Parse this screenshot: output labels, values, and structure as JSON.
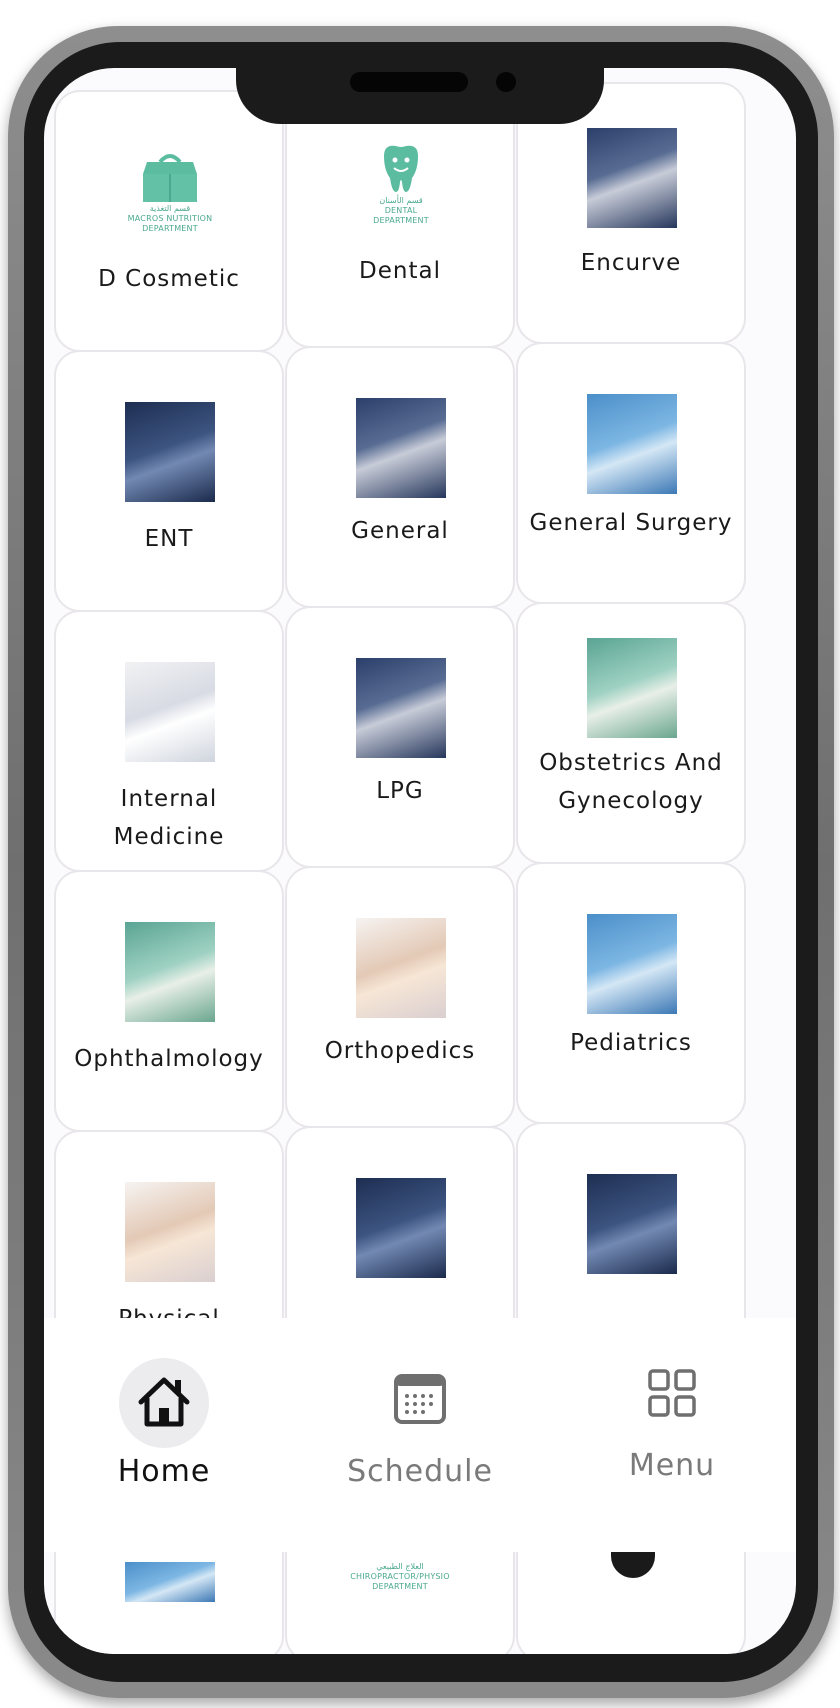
{
  "departments": [
    {
      "label": "D Cosmetic",
      "image": "macros-nutrition-logo",
      "logo_text": "قسم التغذية\nMACROS NUTRITION\nDEPARTMENT"
    },
    {
      "label": "Dental",
      "image": "dental-tooth-logo",
      "logo_text": "قسم الأسنان\nDENTAL\nDEPARTMENT"
    },
    {
      "label": "Encurve",
      "image": "encurve-photo"
    },
    {
      "label": "ENT",
      "image": "ent-photo"
    },
    {
      "label": "General",
      "image": "general-photo"
    },
    {
      "label": "General Surgery",
      "image": "general-surgery-photo"
    },
    {
      "label": "Internal Medicine",
      "image": "internal-medicine-photo"
    },
    {
      "label": "LPG",
      "image": "lpg-photo"
    },
    {
      "label": "Obstetrics And Gynecology",
      "image": "obstetrics-photo"
    },
    {
      "label": "Ophthalmology",
      "image": "ophthalmology-photo"
    },
    {
      "label": "Orthopedics",
      "image": "orthopedics-photo"
    },
    {
      "label": "Pediatrics",
      "image": "pediatrics-photo"
    },
    {
      "label": "Physical Medicine",
      "image": "physical-medicine-photo"
    },
    {
      "label": "",
      "image": "spine-photo"
    },
    {
      "label": "",
      "image": "surgery-photo"
    }
  ],
  "bottom_row_partial": {
    "center_logo_text": "العلاج الطبيعي\nCHIROPRACTOR/PHYSIO\nDEPARTMENT"
  },
  "nav": {
    "home_label": "Home",
    "schedule_label": "Schedule",
    "menu_label": "Menu"
  },
  "colors": {
    "card_border": "#e8e6ea",
    "label_text": "#1a1a1a",
    "nav_active": "#111111",
    "nav_inactive": "#7a7a7a",
    "brand_teal": "#4aa98e",
    "home_highlight": "#ececef"
  }
}
